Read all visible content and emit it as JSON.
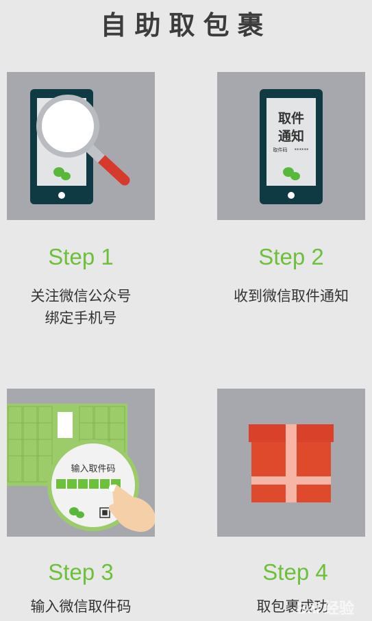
{
  "page_title": "自助取包裹",
  "steps": [
    {
      "label": "Step 1",
      "lines": [
        "关注微信公众号",
        "绑定手机号"
      ]
    },
    {
      "label": "Step 2",
      "lines": [
        "收到微信取件通知"
      ]
    },
    {
      "label": "Step 3",
      "lines": [
        "输入微信取件码"
      ]
    },
    {
      "label": "Step 4",
      "lines": [
        "取包裹成功"
      ]
    }
  ],
  "notice": {
    "title_line1": "取件",
    "title_line2": "通知",
    "code_label": "取件码",
    "code_mask": "******"
  },
  "locker_screen": {
    "prompt": "输入取件码"
  },
  "watermark": "Bai 经验",
  "colors": {
    "card_bg": "#a6a8ae",
    "step_green": "#6cc03a",
    "phone_dark": "#0f3a43",
    "gift_red": "#e04a2c",
    "ribbon_pink": "#f6b5a5"
  }
}
